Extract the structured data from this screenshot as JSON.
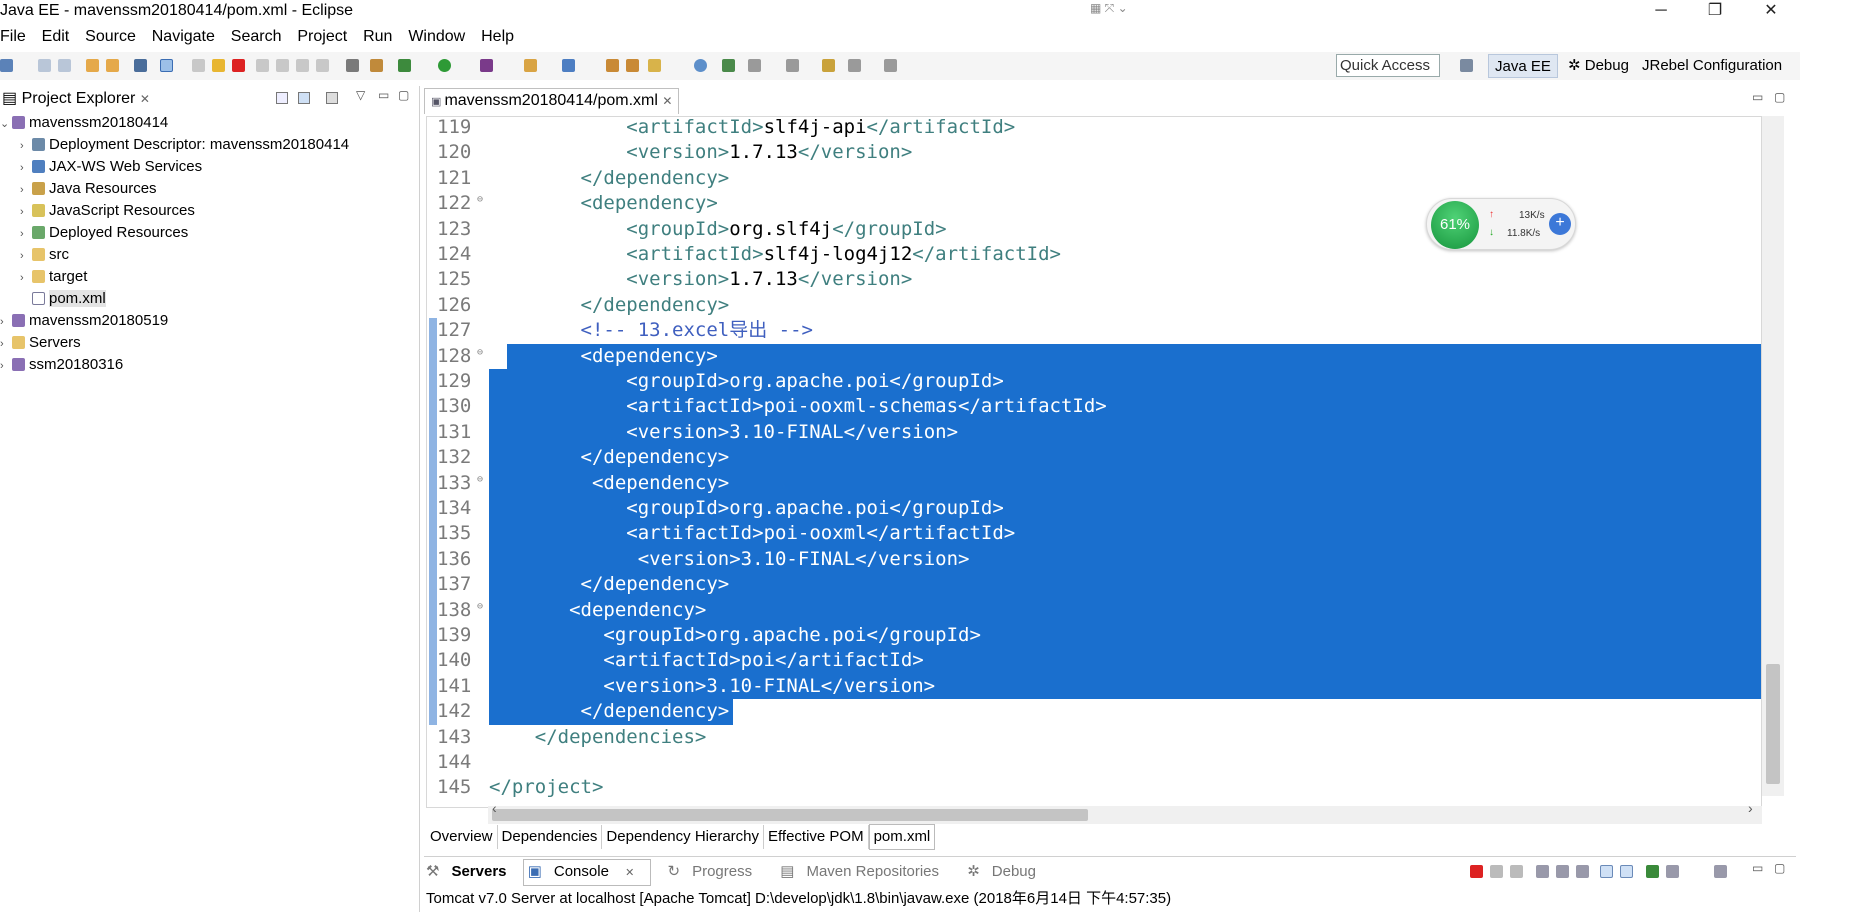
{
  "window": {
    "title": "Java EE - mavenssm20180414/pom.xml - Eclipse",
    "controls": {
      "minimize": "─",
      "maximize": "❐",
      "close": "✕"
    }
  },
  "menu": [
    "File",
    "Edit",
    "Source",
    "Navigate",
    "Search",
    "Project",
    "Run",
    "Window",
    "Help"
  ],
  "toolbar": {
    "quick_access": "Quick Access",
    "perspectives": [
      {
        "label": "Java EE",
        "active": true
      },
      {
        "label": "Debug",
        "active": false
      },
      {
        "label": "JRebel Configuration",
        "active": false
      }
    ]
  },
  "project_explorer": {
    "title": "Project Explorer",
    "close": "✕",
    "items": [
      {
        "label": "mavenssm20180414",
        "expanded": true,
        "icon": "project-icon",
        "depth": 0
      },
      {
        "label": "Deployment Descriptor: mavenssm20180414",
        "icon": "deployment-descriptor-icon",
        "depth": 1
      },
      {
        "label": "JAX-WS Web Services",
        "icon": "web-services-icon",
        "depth": 1
      },
      {
        "label": "Java Resources",
        "icon": "java-resources-icon",
        "depth": 1
      },
      {
        "label": "JavaScript Resources",
        "icon": "javascript-resources-icon",
        "depth": 1
      },
      {
        "label": "Deployed Resources",
        "icon": "deployed-resources-icon",
        "depth": 1
      },
      {
        "label": "src",
        "icon": "folder-icon",
        "depth": 1
      },
      {
        "label": "target",
        "icon": "folder-icon",
        "depth": 1
      },
      {
        "label": "pom.xml",
        "icon": "xml-file-icon",
        "depth": 1,
        "selected": true
      },
      {
        "label": "mavenssm20180519",
        "icon": "project-icon",
        "depth": 0
      },
      {
        "label": "Servers",
        "icon": "folder-icon",
        "depth": 0
      },
      {
        "label": "ssm20180316",
        "icon": "project-icon",
        "depth": 0
      }
    ]
  },
  "editor": {
    "tab_label": "mavenssm20180414/pom.xml",
    "tab_close": "✕",
    "lines": [
      {
        "n": "119",
        "text": "            <artifactId>slf4j-api</artifactId>",
        "sel": false
      },
      {
        "n": "120",
        "text": "            <version>1.7.13</version>",
        "sel": false
      },
      {
        "n": "121",
        "text": "        </dependency>",
        "sel": false
      },
      {
        "n": "122",
        "text": "        <dependency>",
        "sel": false,
        "fold": true
      },
      {
        "n": "123",
        "text": "            <groupId>org.slf4j</groupId>",
        "sel": false
      },
      {
        "n": "124",
        "text": "            <artifactId>slf4j-log4j12</artifactId>",
        "sel": false
      },
      {
        "n": "125",
        "text": "            <version>1.7.13</version>",
        "sel": false
      },
      {
        "n": "126",
        "text": "        </dependency>",
        "sel": false
      },
      {
        "n": "127",
        "text": "        <!-- 13.excel导出 -->",
        "sel": false,
        "comment": true
      },
      {
        "n": "128",
        "text": "        <dependency>",
        "sel": true,
        "fold": true
      },
      {
        "n": "129",
        "text": "            <groupId>org.apache.poi</groupId>",
        "sel": true
      },
      {
        "n": "130",
        "text": "            <artifactId>poi-ooxml-schemas</artifactId>",
        "sel": true
      },
      {
        "n": "131",
        "text": "            <version>3.10-FINAL</version>",
        "sel": true
      },
      {
        "n": "132",
        "text": "        </dependency>",
        "sel": true
      },
      {
        "n": "133",
        "text": "         <dependency>",
        "sel": true,
        "fold": true
      },
      {
        "n": "134",
        "text": "            <groupId>org.apache.poi</groupId>",
        "sel": true
      },
      {
        "n": "135",
        "text": "            <artifactId>poi-ooxml</artifactId>",
        "sel": true
      },
      {
        "n": "136",
        "text": "             <version>3.10-FINAL</version>",
        "sel": true
      },
      {
        "n": "137",
        "text": "        </dependency>",
        "sel": true
      },
      {
        "n": "138",
        "text": "       <dependency>",
        "sel": true,
        "fold": true
      },
      {
        "n": "139",
        "text": "          <groupId>org.apache.poi</groupId>",
        "sel": true
      },
      {
        "n": "140",
        "text": "          <artifactId>poi</artifactId>",
        "sel": true
      },
      {
        "n": "141",
        "text": "          <version>3.10-FINAL</version>",
        "sel": true
      },
      {
        "n": "142",
        "text": "        </dependency>",
        "sel": true
      },
      {
        "n": "143",
        "text": "    </dependencies>",
        "sel": false
      },
      {
        "n": "144",
        "text": "",
        "sel": false
      },
      {
        "n": "145",
        "text": "</project>",
        "sel": false
      }
    ],
    "bottom_tabs": [
      {
        "label": "Overview",
        "active": false
      },
      {
        "label": "Dependencies",
        "active": false
      },
      {
        "label": "Dependency Hierarchy",
        "active": false
      },
      {
        "label": "Effective POM",
        "active": false
      },
      {
        "label": "pom.xml",
        "active": true
      }
    ]
  },
  "net_monitor": {
    "percent": "61%",
    "upload": "13K/s",
    "download": "11.8K/s"
  },
  "bottom_panel": {
    "tabs": [
      {
        "label": "Servers",
        "active": false
      },
      {
        "label": "Console",
        "active": true
      },
      {
        "label": "Progress",
        "active": false
      },
      {
        "label": "Maven Repositories",
        "active": false
      },
      {
        "label": "Debug",
        "active": false
      }
    ],
    "console_text": "Tomcat v7.0 Server at localhost [Apache Tomcat] D:\\develop\\jdk\\1.8\\bin\\javaw.exe (2018年6月14日 下午4:57:35)"
  },
  "colors": {
    "selection": "#1a6fce",
    "tag": "#3f7f7f",
    "comment": "#3f5fbf"
  }
}
